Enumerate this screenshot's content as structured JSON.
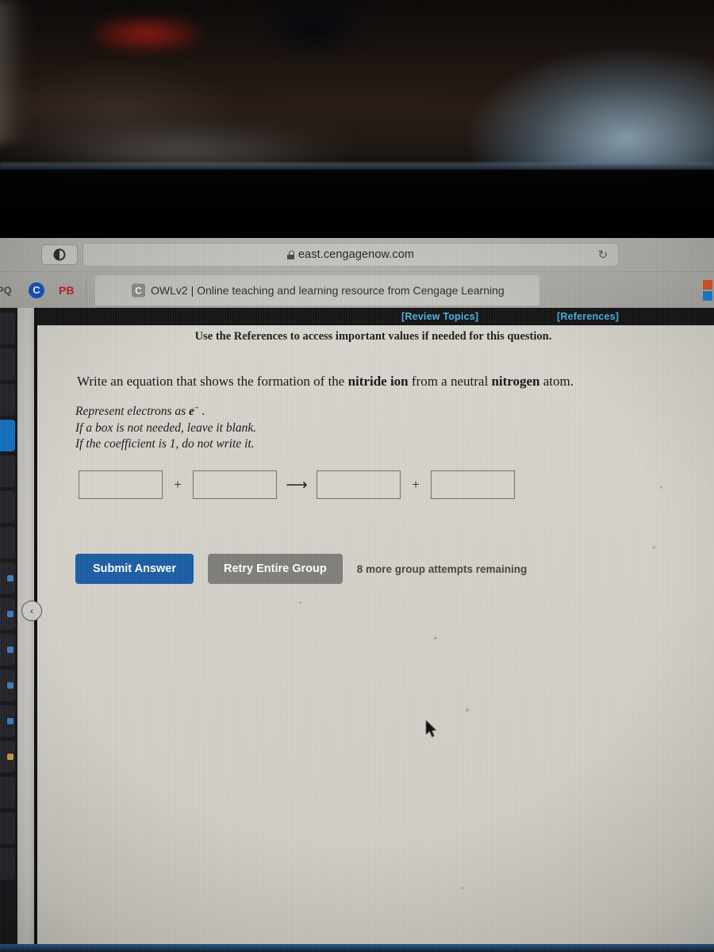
{
  "browser": {
    "url": "east.cengagenow.com",
    "lock_icon": "lock-icon",
    "reader_icon": "reader-view-icon",
    "reload_icon": "↻",
    "favorites": [
      {
        "label": "PQ",
        "name": "bookmark-pq"
      },
      {
        "label": "C",
        "name": "bookmark-c"
      },
      {
        "label": "PB",
        "name": "bookmark-pb"
      }
    ],
    "tab": {
      "favicon_letter": "C",
      "title": "OWLv2 | Online teaching and learning resource from Cengage Learning"
    }
  },
  "sidebar": {
    "collapse_chevron": "‹"
  },
  "page": {
    "topbar": {
      "review_topics": "[Review Topics]",
      "references": "[References]"
    },
    "use_references_note": "Use the References to access important values if needed for this question.",
    "question": {
      "prefix": "Write an equation that shows the formation of the ",
      "bold1": "nitride ion",
      "middle": " from a neutral ",
      "bold2": "nitrogen",
      "suffix": " atom."
    },
    "instructions": {
      "line1_prefix": "Represent electrons as ",
      "line1_symbol": "e",
      "line1_superscript": "−",
      "line1_suffix": " .",
      "line2": "If a box is not needed, leave it blank.",
      "line3": "If the coefficient is 1, do not write it."
    },
    "equation": {
      "box1_value": "",
      "box2_value": "",
      "box3_value": "",
      "box4_value": "",
      "plus1": "+",
      "arrow": "⟶",
      "plus2": "+"
    },
    "actions": {
      "submit_label": "Submit Answer",
      "retry_label": "Retry Entire Group",
      "attempts_text": "8 more group attempts remaining"
    },
    "colors": {
      "submit_blue": "#1a5ca5",
      "retry_gray": "#7f7e79",
      "link_blue": "#4ab4e8",
      "page_background": "#d5d3cb"
    }
  }
}
